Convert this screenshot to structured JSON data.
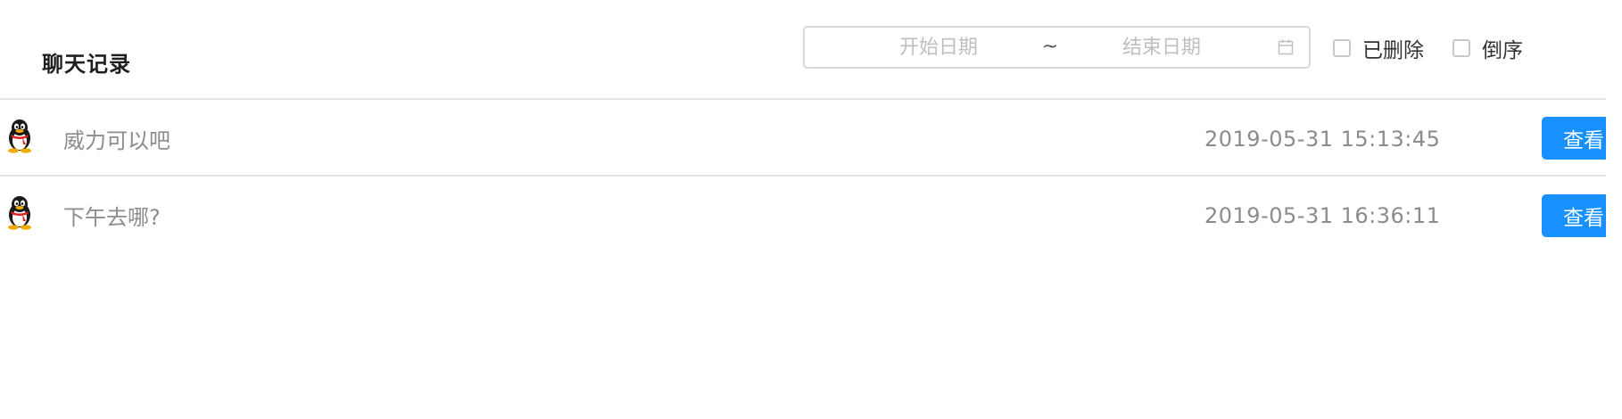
{
  "header": {
    "title": "聊天记录"
  },
  "filter": {
    "date_start_placeholder": "开始日期",
    "date_separator": "~",
    "date_end_placeholder": "结束日期",
    "deleted_label": "已删除",
    "reverse_label": "倒序",
    "deleted_checked": false,
    "reverse_checked": false
  },
  "messages": [
    {
      "avatar_icon": "qq-penguin-icon",
      "text": "威力可以吧",
      "time": "2019-05-31 15:13:45",
      "action_label": "查看"
    },
    {
      "avatar_icon": "qq-penguin-icon",
      "text": "下午去哪?",
      "time": "2019-05-31 16:36:11",
      "action_label": "查看"
    }
  ],
  "colors": {
    "primary": "#1890ff",
    "border": "#d9d9d9",
    "muted_text": "#8c8c8c"
  }
}
